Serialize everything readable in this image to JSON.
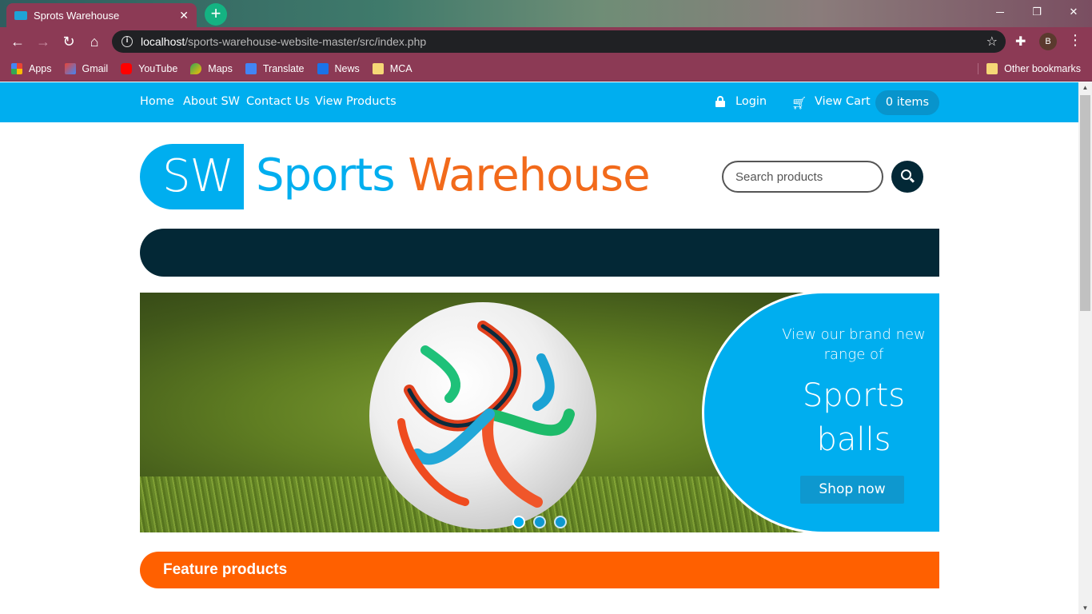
{
  "browser": {
    "tab_title": "Sprots Warehouse",
    "tab_close": "✕",
    "new_tab": "+",
    "url_host": "localhost",
    "url_path": "/sports-warehouse-website-master/src/index.php",
    "profile_initial": "B",
    "bookmarks": [
      {
        "label": "Apps",
        "icon": "apps-icon"
      },
      {
        "label": "Gmail",
        "icon": "gmail-icon"
      },
      {
        "label": "YouTube",
        "icon": "youtube-icon"
      },
      {
        "label": "Maps",
        "icon": "maps-icon"
      },
      {
        "label": "Translate",
        "icon": "translate-icon"
      },
      {
        "label": "News",
        "icon": "news-icon"
      },
      {
        "label": "MCA",
        "icon": "folder-icon"
      }
    ],
    "other_bookmarks": "Other bookmarks"
  },
  "site_nav": {
    "links": [
      "Home",
      "About SW",
      "Contact Us",
      "View Products"
    ],
    "login": "Login",
    "view_cart": "View Cart",
    "items": "0 items"
  },
  "logo": {
    "badge": "SW",
    "word1": "Sports",
    "word2": "Warehouse"
  },
  "search": {
    "placeholder": "Search products"
  },
  "hero": {
    "promo_line": "View our brand new range of",
    "promo_big": "Sports balls",
    "cta": "Shop now",
    "slides": 3,
    "active_slide": 1
  },
  "feature": {
    "title": "Feature products"
  },
  "colors": {
    "brand_blue": "#00aeef",
    "brand_orange": "#f26a1b",
    "dark_navy": "#032836",
    "feature_orange": "#ff6000"
  }
}
